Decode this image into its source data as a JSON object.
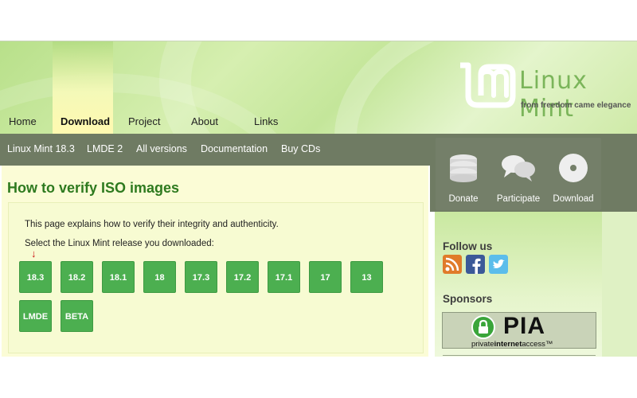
{
  "nav": {
    "items": [
      "Home",
      "Download",
      "Project",
      "About",
      "Links"
    ],
    "active": "Download"
  },
  "logo": {
    "text": "Linux Mint",
    "tagline": "from freedom came elegance"
  },
  "subnav": {
    "items": [
      "Linux Mint 18.3",
      "LMDE 2",
      "All versions",
      "Documentation",
      "Buy CDs"
    ]
  },
  "sidebar_buttons": [
    {
      "label": "Donate",
      "icon": "coins-stack-icon"
    },
    {
      "label": "Participate",
      "icon": "chat-bubbles-icon"
    },
    {
      "label": "Download",
      "icon": "disc-icon"
    }
  ],
  "main": {
    "title": "How to verify ISO images",
    "intro": "This page explains how to verify their integrity and authenticity.",
    "prompt": "Select the Linux Mint release you downloaded:",
    "versions": [
      "18.3",
      "18.2",
      "18.1",
      "18",
      "17.3",
      "17.2",
      "17.1",
      "17",
      "13",
      "LMDE",
      "BETA"
    ],
    "selected_indicator": "↓"
  },
  "sidebar": {
    "follow_heading": "Follow us",
    "social": [
      "rss-icon",
      "facebook-icon",
      "twitter-icon"
    ],
    "sponsors_heading": "Sponsors",
    "sponsor": {
      "name": "PIA",
      "sub_prefix": "private",
      "sub_bold": "internet",
      "sub_suffix": "access™"
    }
  },
  "colors": {
    "accent_green": "#4caf50",
    "title_green": "#2e7a1f",
    "subnav_bg": "#6f7b63",
    "highlight_yellow": "#fff9b0"
  }
}
